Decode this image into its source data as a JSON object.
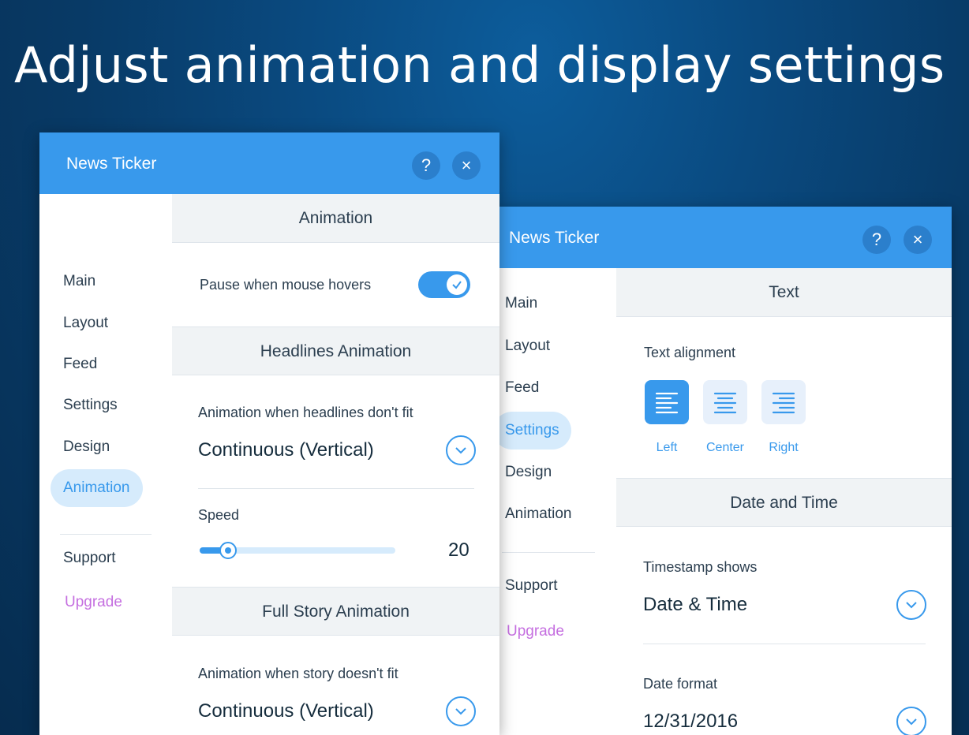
{
  "headline": "Adjust animation and display settings",
  "panel_front": {
    "title": "News Ticker",
    "help_label": "?",
    "close_label": "×",
    "nav": [
      "Main",
      "Layout",
      "Feed",
      "Settings",
      "Design",
      "Animation"
    ],
    "nav_active": "Animation",
    "support": "Support",
    "upgrade": "Upgrade",
    "sections": {
      "animation": {
        "header": "Animation",
        "pause_label": "Pause when mouse hovers",
        "pause_on": true
      },
      "headlines": {
        "header": "Headlines Animation",
        "mode_label": "Animation when headlines don't fit",
        "mode_value": "Continuous (Vertical)",
        "speed_label": "Speed",
        "speed_value": "20"
      },
      "full_story": {
        "header": "Full Story Animation",
        "mode_label": "Animation when story doesn't fit",
        "mode_value": "Continuous (Vertical)"
      }
    }
  },
  "panel_back": {
    "title": "News Ticker",
    "help_label": "?",
    "close_label": "×",
    "nav": [
      "Main",
      "Layout",
      "Feed",
      "Settings",
      "Design",
      "Animation"
    ],
    "nav_active": "Settings",
    "support": "Support",
    "upgrade": "Upgrade",
    "sections": {
      "text": {
        "header": "Text",
        "alignment_label": "Text alignment",
        "alignment_options": [
          "Left",
          "Center",
          "Right"
        ],
        "alignment_selected": "Left"
      },
      "date_time": {
        "header": "Date and Time",
        "timestamp_label": "Timestamp shows",
        "timestamp_value": "Date & Time",
        "date_format_label": "Date format",
        "date_format_value": "12/31/2016"
      }
    }
  },
  "icons": [
    "help-icon",
    "close-icon",
    "chevron-down-icon",
    "check-icon",
    "align-left-icon",
    "align-center-icon",
    "align-right-icon"
  ],
  "colors": {
    "accent": "#3899ec",
    "upgrade": "#c56fe0",
    "active_nav_bg": "#d6ebfc"
  }
}
